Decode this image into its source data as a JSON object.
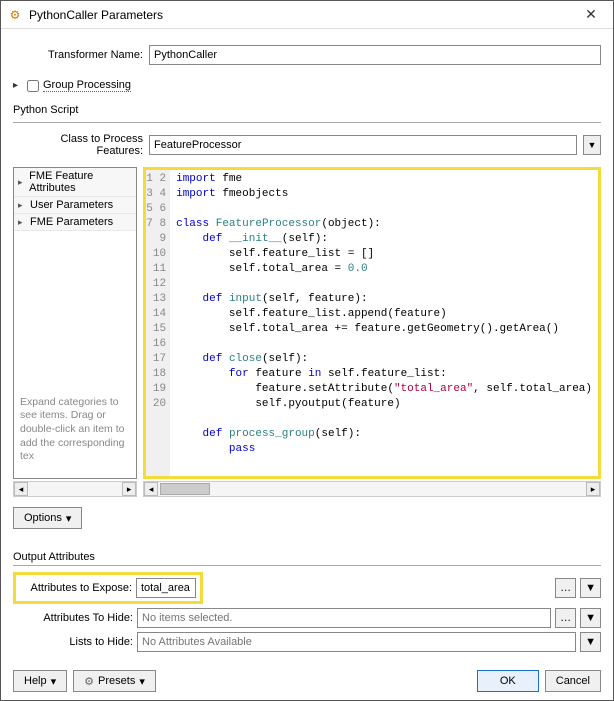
{
  "window": {
    "title": "PythonCaller Parameters"
  },
  "transformer": {
    "label": "Transformer Name:",
    "value": "PythonCaller"
  },
  "groupProcessing": {
    "label": "Group Processing",
    "checked": false
  },
  "pyScript": {
    "label": "Python Script"
  },
  "classRow": {
    "label": "Class to Process Features:",
    "value": "FeatureProcessor"
  },
  "tree": {
    "items": [
      "FME Feature Attributes",
      "User Parameters",
      "FME Parameters"
    ],
    "hint": "Expand categories to see items.\nDrag or double-click an item\nto add the corresponding tex"
  },
  "code": {
    "lines": [
      [
        {
          "t": "kw",
          "v": "import"
        },
        {
          "t": "",
          "v": " fme"
        }
      ],
      [
        {
          "t": "kw",
          "v": "import"
        },
        {
          "t": "",
          "v": " fmeobjects"
        }
      ],
      [
        {
          "t": "",
          "v": ""
        }
      ],
      [
        {
          "t": "kw",
          "v": "class"
        },
        {
          "t": "",
          "v": " "
        },
        {
          "t": "cls",
          "v": "FeatureProcessor"
        },
        {
          "t": "",
          "v": "(object):"
        }
      ],
      [
        {
          "t": "",
          "v": "    "
        },
        {
          "t": "kw",
          "v": "def"
        },
        {
          "t": "",
          "v": " "
        },
        {
          "t": "fn",
          "v": "__init__"
        },
        {
          "t": "",
          "v": "(self):"
        }
      ],
      [
        {
          "t": "",
          "v": "        self.feature_list = []"
        }
      ],
      [
        {
          "t": "",
          "v": "        self.total_area = "
        },
        {
          "t": "num",
          "v": "0.0"
        }
      ],
      [
        {
          "t": "",
          "v": ""
        }
      ],
      [
        {
          "t": "",
          "v": "    "
        },
        {
          "t": "kw",
          "v": "def"
        },
        {
          "t": "",
          "v": " "
        },
        {
          "t": "fn",
          "v": "input"
        },
        {
          "t": "",
          "v": "(self, feature):"
        }
      ],
      [
        {
          "t": "",
          "v": "        self.feature_list.append(feature)"
        }
      ],
      [
        {
          "t": "",
          "v": "        self.total_area += feature.getGeometry().getArea()"
        }
      ],
      [
        {
          "t": "",
          "v": ""
        }
      ],
      [
        {
          "t": "",
          "v": "    "
        },
        {
          "t": "kw",
          "v": "def"
        },
        {
          "t": "",
          "v": " "
        },
        {
          "t": "fn",
          "v": "close"
        },
        {
          "t": "",
          "v": "(self):"
        }
      ],
      [
        {
          "t": "",
          "v": "        "
        },
        {
          "t": "kw",
          "v": "for"
        },
        {
          "t": "",
          "v": " feature "
        },
        {
          "t": "kw",
          "v": "in"
        },
        {
          "t": "",
          "v": " self.feature_list:"
        }
      ],
      [
        {
          "t": "",
          "v": "            feature.setAttribute("
        },
        {
          "t": "str",
          "v": "\"total_area\""
        },
        {
          "t": "",
          "v": ", self.total_area)"
        }
      ],
      [
        {
          "t": "",
          "v": "            self.pyoutput(feature)"
        }
      ],
      [
        {
          "t": "",
          "v": ""
        }
      ],
      [
        {
          "t": "",
          "v": "    "
        },
        {
          "t": "kw",
          "v": "def"
        },
        {
          "t": "",
          "v": " "
        },
        {
          "t": "fn",
          "v": "process_group"
        },
        {
          "t": "",
          "v": "(self):"
        }
      ],
      [
        {
          "t": "",
          "v": "        "
        },
        {
          "t": "kw",
          "v": "pass"
        }
      ],
      [
        {
          "t": "",
          "v": ""
        }
      ]
    ]
  },
  "options": {
    "label": "Options"
  },
  "output": {
    "label": "Output Attributes",
    "expose": {
      "label": "Attributes to Expose:",
      "value": "total_area"
    },
    "hide": {
      "label": "Attributes To Hide:",
      "placeholder": "No items selected."
    },
    "lists": {
      "label": "Lists to Hide:",
      "placeholder": "No Attributes Available"
    }
  },
  "footer": {
    "help": "Help",
    "presets": "Presets",
    "ok": "OK",
    "cancel": "Cancel"
  }
}
